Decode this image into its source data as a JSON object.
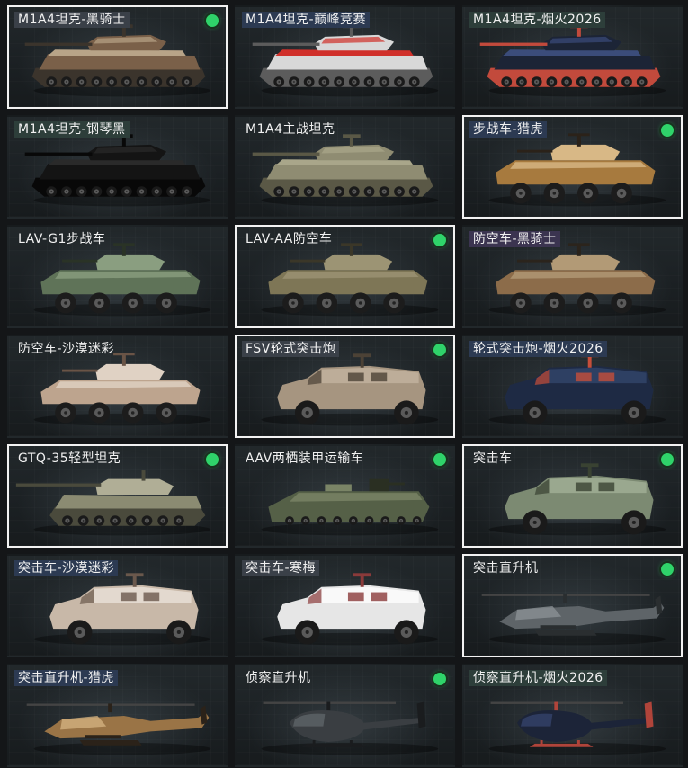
{
  "vehicles": [
    {
      "name": "M1A4坦克-黑骑士",
      "selected": true,
      "owned": true,
      "tag": "dark",
      "kind": "tank",
      "paint": [
        "#7a6049",
        "#b8a488",
        "#3b342c"
      ]
    },
    {
      "name": "M1A4坦克-巅峰竞赛",
      "selected": false,
      "owned": false,
      "tag": "blue",
      "kind": "tank",
      "paint": [
        "#d8d8d8",
        "#d0302a",
        "#5c5c5c"
      ]
    },
    {
      "name": "M1A4坦克-烟火2026",
      "selected": false,
      "owned": false,
      "tag": "green",
      "kind": "tank",
      "paint": [
        "#1c2436",
        "#3b4c7a",
        "#c24a3c"
      ]
    },
    {
      "name": "M1A4坦克-钢琴黑",
      "selected": false,
      "owned": false,
      "tag": "green",
      "kind": "tank",
      "paint": [
        "#141414",
        "#2a2a2a",
        "#080808"
      ]
    },
    {
      "name": "M1A4主战坦克",
      "selected": false,
      "owned": false,
      "tag": "none",
      "kind": "tank",
      "paint": [
        "#8f8c72",
        "#a9a68a",
        "#5a5846"
      ]
    },
    {
      "name": "步战车-猎虎",
      "selected": true,
      "owned": true,
      "tag": "blue",
      "kind": "apc",
      "paint": [
        "#a77a3e",
        "#d8b886",
        "#2b2219"
      ]
    },
    {
      "name": "LAV-G1步战车",
      "selected": false,
      "owned": false,
      "tag": "none",
      "kind": "apc",
      "paint": [
        "#5f7358",
        "#8a9e80",
        "#2a3326"
      ]
    },
    {
      "name": "LAV-AA防空车",
      "selected": true,
      "owned": true,
      "tag": "none",
      "kind": "apc",
      "paint": [
        "#7e7656",
        "#9c9474",
        "#3b3728"
      ]
    },
    {
      "name": "防空车-黑骑士",
      "selected": false,
      "owned": false,
      "tag": "purple",
      "kind": "apc",
      "paint": [
        "#8c6c4a",
        "#b29a76",
        "#2b241c"
      ]
    },
    {
      "name": "防空车-沙漠迷彩",
      "selected": false,
      "owned": false,
      "tag": "none",
      "kind": "apc",
      "paint": [
        "#bda48e",
        "#e0d2c4",
        "#6a5446"
      ]
    },
    {
      "name": "FSV轮式突击炮",
      "selected": true,
      "owned": true,
      "tag": "dark",
      "kind": "truck",
      "paint": [
        "#a69580",
        "#c4b6a2",
        "#4c4236"
      ]
    },
    {
      "name": "轮式突击炮-烟火2026",
      "selected": false,
      "owned": false,
      "tag": "blue",
      "kind": "truck",
      "paint": [
        "#1e2a44",
        "#34486e",
        "#c64e3a"
      ]
    },
    {
      "name": "GTQ-35轻型坦克",
      "selected": true,
      "owned": true,
      "tag": "none",
      "kind": "light-tank",
      "paint": [
        "#8b8b72",
        "#b0ae96",
        "#4a4a3c"
      ]
    },
    {
      "name": "AAV两栖装甲运输车",
      "selected": false,
      "owned": true,
      "tag": "none",
      "kind": "amphibious",
      "paint": [
        "#556047",
        "#7a8466",
        "#2a2f22"
      ]
    },
    {
      "name": "突击车",
      "selected": true,
      "owned": true,
      "tag": "none",
      "kind": "truck",
      "paint": [
        "#7c8a72",
        "#a4b29a",
        "#394232"
      ]
    },
    {
      "name": "突击车-沙漠迷彩",
      "selected": false,
      "owned": false,
      "tag": "blue",
      "kind": "truck",
      "paint": [
        "#c8b8a8",
        "#ece4dc",
        "#6a584c"
      ]
    },
    {
      "name": "突击车-寒梅",
      "selected": false,
      "owned": false,
      "tag": "dark",
      "kind": "truck",
      "paint": [
        "#e6e6e6",
        "#ffffff",
        "#8a3a3a"
      ]
    },
    {
      "name": "突击直升机",
      "selected": true,
      "owned": true,
      "tag": "none",
      "kind": "attack-heli",
      "paint": [
        "#5e6468",
        "#8a9094",
        "#2a2e30"
      ]
    },
    {
      "name": "突击直升机-猎虎",
      "selected": false,
      "owned": false,
      "tag": "blue",
      "kind": "attack-heli",
      "paint": [
        "#9a7446",
        "#d2b07e",
        "#2b2219"
      ]
    },
    {
      "name": "侦察直升机",
      "selected": false,
      "owned": true,
      "tag": "none",
      "kind": "scout-heli",
      "paint": [
        "#3a3e42",
        "#5e6468",
        "#1a1c1e"
      ]
    },
    {
      "name": "侦察直升机-烟火2026",
      "selected": false,
      "owned": false,
      "tag": "green",
      "kind": "scout-heli",
      "paint": [
        "#1c2438",
        "#34426a",
        "#b0443a"
      ]
    }
  ],
  "indicator_color": "#2fd36a",
  "selection_border_color": "#f2f2f2"
}
